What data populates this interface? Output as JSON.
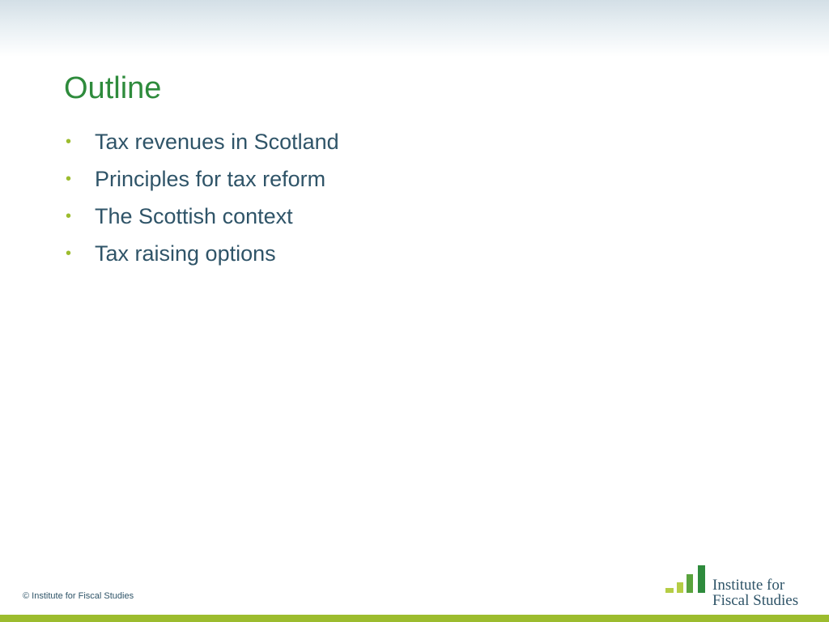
{
  "slide": {
    "title": "Outline",
    "bullets": [
      "Tax revenues in Scotland",
      "Principles for tax reform",
      "The Scottish context",
      "Tax raising options"
    ]
  },
  "footer": {
    "copyright": "© Institute for Fiscal Studies",
    "logo_line1": "Institute for",
    "logo_line2": "Fiscal Studies"
  },
  "colors": {
    "title": "#2e8b3c",
    "text": "#2f5468",
    "bullet": "#9cbc2e",
    "footer_bar": "#9cbc2e",
    "logo_bar_light": "#b5cd45",
    "logo_bar_dark": "#2e8b3c"
  },
  "icons": {
    "logo": "bar-chart-logo-icon"
  }
}
